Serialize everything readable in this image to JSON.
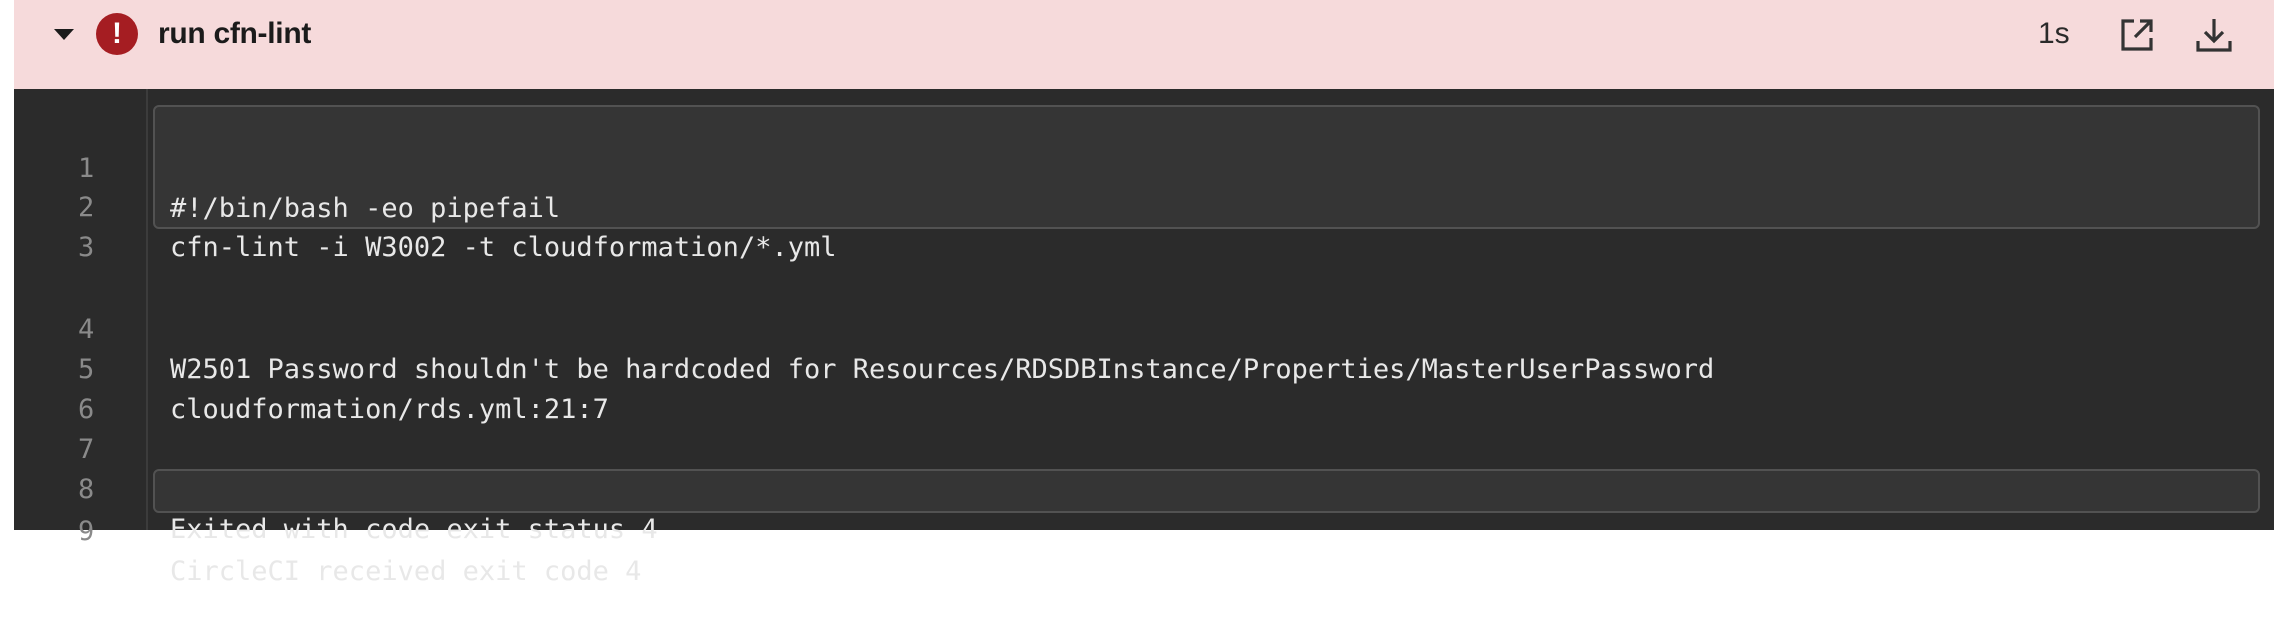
{
  "step": {
    "title": "run cfn-lint",
    "status_icon": "error-icon",
    "status_symbol": "!",
    "duration": "1s",
    "accent_color": "#a51d22",
    "header_bg": "#f6dadb"
  },
  "output": {
    "lines": [
      {
        "num": "1",
        "text": "#!/bin/bash -eo pipefail"
      },
      {
        "num": "2",
        "text": "cfn-lint -i W3002 -t cloudformation/*.yml"
      },
      {
        "num": "3",
        "text": ""
      },
      {
        "num": "4",
        "text": "W2501 Password shouldn't be hardcoded for Resources/RDSDBInstance/Properties/MasterUserPassword"
      },
      {
        "num": "5",
        "text": "cloudformation/rds.yml:21:7"
      },
      {
        "num": "6",
        "text": ""
      },
      {
        "num": "7",
        "text": ""
      },
      {
        "num": "8",
        "text": "Exited with code exit status 4"
      },
      {
        "num": "9",
        "text": "CircleCI received exit code 4"
      }
    ]
  }
}
